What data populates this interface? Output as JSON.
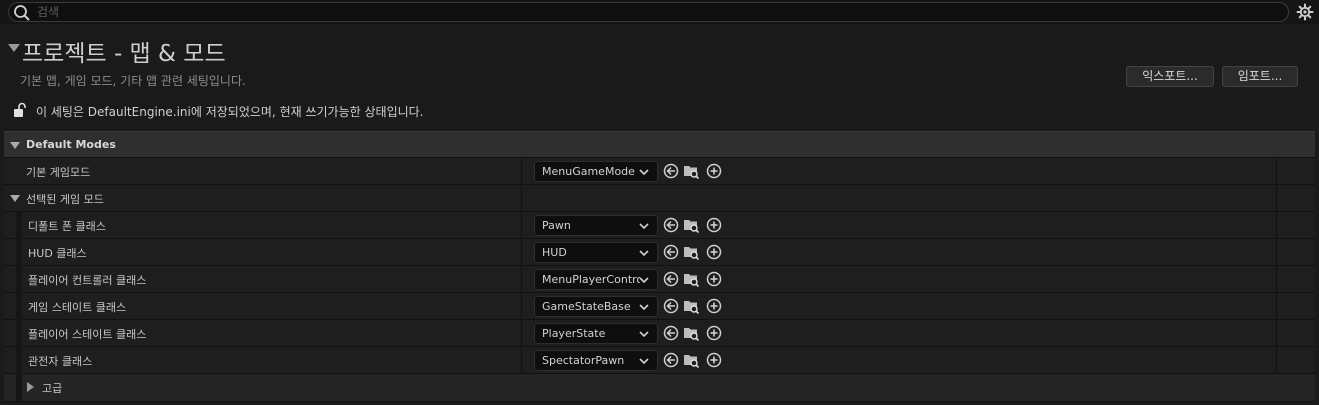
{
  "search": {
    "placeholder": "검색"
  },
  "header": {
    "title": "프로젝트 - 맵 & 모드",
    "description": "기본 맵, 게임 모드, 기타 맵 관련 세팅입니다.",
    "export_label": "익스포트...",
    "import_label": "임포트..."
  },
  "status": {
    "save_text": "이 세팅은 DefaultEngine.ini에 저장되었으며, 현재 쓰기가능한 상태입니다."
  },
  "section": {
    "title": "Default Modes"
  },
  "rows": {
    "default_gamemode": {
      "label": "기본 게임모드",
      "value": "MenuGameMode"
    },
    "selected_gamemode": {
      "label": "선택된 게임 모드"
    },
    "default_pawn": {
      "label": "디폴트 폰 클래스",
      "value": "Pawn"
    },
    "hud": {
      "label": "HUD 클래스",
      "value": "HUD"
    },
    "player_controller": {
      "label": "플레이어 컨트롤러 클래스",
      "value": "MenuPlayerController"
    },
    "game_state": {
      "label": "게임 스테이트 클래스",
      "value": "GameStateBase"
    },
    "player_state": {
      "label": "플레이어 스테이트 클래스",
      "value": "PlayerState"
    },
    "spectator": {
      "label": "관전자 클래스",
      "value": "SpectatorPawn"
    },
    "advanced": {
      "label": "고급"
    }
  },
  "icons": {
    "search": "search-icon",
    "settings": "gear-icon",
    "lock": "unlock-icon",
    "use_selected": "arrow-left-circle-icon",
    "browse": "folder-search-icon",
    "create": "plus-circle-icon"
  },
  "colors": {
    "background": "#1a1a1a",
    "row_background": "#1e1e1e",
    "section_background": "#2f2f2f",
    "combo_background": "#0e0e0e",
    "text": "#c8c8c8"
  }
}
